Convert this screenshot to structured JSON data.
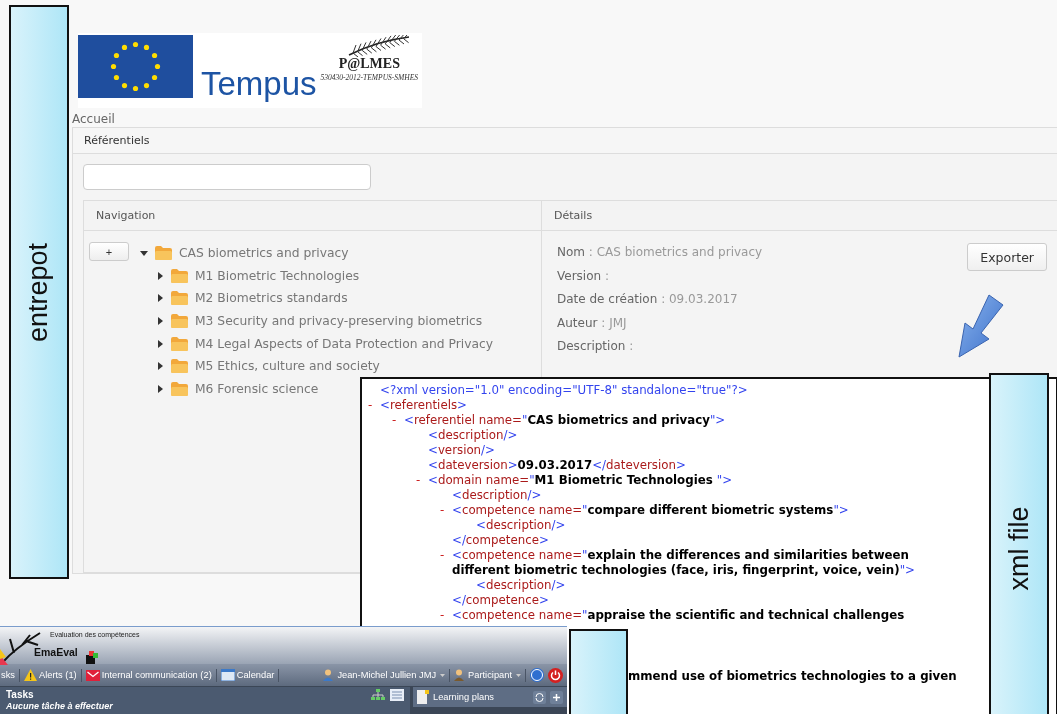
{
  "side_labels": {
    "left": "entrepot",
    "right": "xml file"
  },
  "logo": {
    "wordmark": "Tempus",
    "project": "P@LMES",
    "project_code": "530430-2012-TEMPUS-SMHES"
  },
  "breadcrumb": "Accueil",
  "panel": {
    "title": "Référentiels"
  },
  "navigation": {
    "title": "Navigation",
    "add_button": "+",
    "tree": [
      {
        "label": "CAS biometrics and privacy",
        "expanded": true,
        "children": [
          {
            "label": "M1 Biometric Technologies",
            "expanded": false
          },
          {
            "label": "M2 Biometrics standards",
            "expanded": false
          },
          {
            "label": "M3 Security and privacy-preserving biometrics",
            "expanded": false
          },
          {
            "label": "M4 Legal Aspects of Data Protection and Privacy",
            "expanded": false
          },
          {
            "label": "M5 Ethics, culture and society",
            "expanded": false
          },
          {
            "label": "M6 Forensic science",
            "expanded": false
          }
        ]
      }
    ]
  },
  "details": {
    "title": "Détails",
    "export_button": "Exporter",
    "fields": [
      {
        "label": "Nom",
        "value": ": CAS biometrics and privacy"
      },
      {
        "label": "Version",
        "value": ":"
      },
      {
        "label": "Date de création",
        "value": ": 09.03.2017"
      },
      {
        "label": "Auteur",
        "value": ": JMJ"
      },
      {
        "label": "Description",
        "value": ":"
      }
    ]
  },
  "xml": {
    "declaration": "<?xml version=\"1.0\" encoding=\"UTF-8\" standalone=\"true\"?>",
    "nodes": [
      {
        "toggle": "-",
        "segments": [
          {
            "kind": "p",
            "text": "<"
          },
          {
            "kind": "n",
            "text": "referentiels"
          },
          {
            "kind": "p",
            "text": ">"
          }
        ],
        "children": [
          {
            "toggle": "-",
            "segments": [
              {
                "kind": "p",
                "text": "<"
              },
              {
                "kind": "n",
                "text": "referentiel name="
              },
              {
                "kind": "p",
                "text": "\""
              },
              {
                "kind": "v",
                "text": "CAS biometrics and privacy"
              },
              {
                "kind": "p",
                "text": "\">"
              }
            ],
            "children": [
              {
                "segments": [
                  {
                    "kind": "p",
                    "text": "<"
                  },
                  {
                    "kind": "n",
                    "text": "description"
                  },
                  {
                    "kind": "p",
                    "text": "/>"
                  }
                ]
              },
              {
                "segments": [
                  {
                    "kind": "p",
                    "text": "<"
                  },
                  {
                    "kind": "n",
                    "text": "version"
                  },
                  {
                    "kind": "p",
                    "text": "/>"
                  }
                ]
              },
              {
                "segments": [
                  {
                    "kind": "p",
                    "text": "<"
                  },
                  {
                    "kind": "n",
                    "text": "dateversion"
                  },
                  {
                    "kind": "p",
                    "text": ">"
                  },
                  {
                    "kind": "v",
                    "text": "09.03.2017"
                  },
                  {
                    "kind": "p",
                    "text": "</"
                  },
                  {
                    "kind": "n",
                    "text": "dateversion"
                  },
                  {
                    "kind": "p",
                    "text": ">"
                  }
                ]
              },
              {
                "toggle": "-",
                "segments": [
                  {
                    "kind": "p",
                    "text": "<"
                  },
                  {
                    "kind": "n",
                    "text": "domain name="
                  },
                  {
                    "kind": "p",
                    "text": "\""
                  },
                  {
                    "kind": "v",
                    "text": "M1 Biometric Technologies "
                  },
                  {
                    "kind": "p",
                    "text": "\">"
                  }
                ],
                "children": [
                  {
                    "segments": [
                      {
                        "kind": "p",
                        "text": "<"
                      },
                      {
                        "kind": "n",
                        "text": "description"
                      },
                      {
                        "kind": "p",
                        "text": "/>"
                      }
                    ]
                  },
                  {
                    "toggle": "-",
                    "segments": [
                      {
                        "kind": "p",
                        "text": "<"
                      },
                      {
                        "kind": "n",
                        "text": "competence name="
                      },
                      {
                        "kind": "p",
                        "text": "\""
                      },
                      {
                        "kind": "v",
                        "text": "compare different biometric systems"
                      },
                      {
                        "kind": "p",
                        "text": "\">"
                      }
                    ],
                    "children": [
                      {
                        "segments": [
                          {
                            "kind": "p",
                            "text": "<"
                          },
                          {
                            "kind": "n",
                            "text": "description"
                          },
                          {
                            "kind": "p",
                            "text": "/>"
                          }
                        ]
                      }
                    ],
                    "closing": [
                      {
                        "kind": "p",
                        "text": "</"
                      },
                      {
                        "kind": "n",
                        "text": "competence"
                      },
                      {
                        "kind": "p",
                        "text": ">"
                      }
                    ]
                  },
                  {
                    "toggle": "-",
                    "segments": [
                      {
                        "kind": "p",
                        "text": "<"
                      },
                      {
                        "kind": "n",
                        "text": "competence name="
                      },
                      {
                        "kind": "p",
                        "text": "\""
                      },
                      {
                        "kind": "v",
                        "text": "explain the differences and similarities between different biometric technologies (face, iris, fingerprint, voice, vein)"
                      },
                      {
                        "kind": "p",
                        "text": "\">"
                      }
                    ],
                    "children": [
                      {
                        "segments": [
                          {
                            "kind": "p",
                            "text": "<"
                          },
                          {
                            "kind": "n",
                            "text": "description"
                          },
                          {
                            "kind": "p",
                            "text": "/>"
                          }
                        ]
                      }
                    ],
                    "closing": [
                      {
                        "kind": "p",
                        "text": "</"
                      },
                      {
                        "kind": "n",
                        "text": "competence"
                      },
                      {
                        "kind": "p",
                        "text": ">"
                      }
                    ]
                  },
                  {
                    "toggle": "-",
                    "segments": [
                      {
                        "kind": "p",
                        "text": "<"
                      },
                      {
                        "kind": "n",
                        "text": "competence name="
                      },
                      {
                        "kind": "p",
                        "text": "\""
                      },
                      {
                        "kind": "v",
                        "text": "appraise the scientific and technical challenges"
                      }
                    ]
                  }
                ]
              }
            ]
          }
        ]
      }
    ],
    "fragment": "mmend use of biometrics technologies to a given"
  },
  "emaeval": {
    "subtitle": "Evaluation des compétences",
    "app_name": "EmaEval",
    "toolbar": [
      {
        "kind": "text",
        "label": "sks"
      },
      {
        "kind": "alert",
        "label": "Alerts (1)"
      },
      {
        "kind": "mail",
        "label": "Internal communication (2)"
      },
      {
        "kind": "calendar",
        "label": "Calendar"
      }
    ],
    "user": "Jean-Michel Jullien JMJ",
    "role": "Participant",
    "tasks": {
      "title": "Tasks",
      "empty": "Aucune tâche à effectuer"
    },
    "learning_plans": "Learning plans"
  }
}
